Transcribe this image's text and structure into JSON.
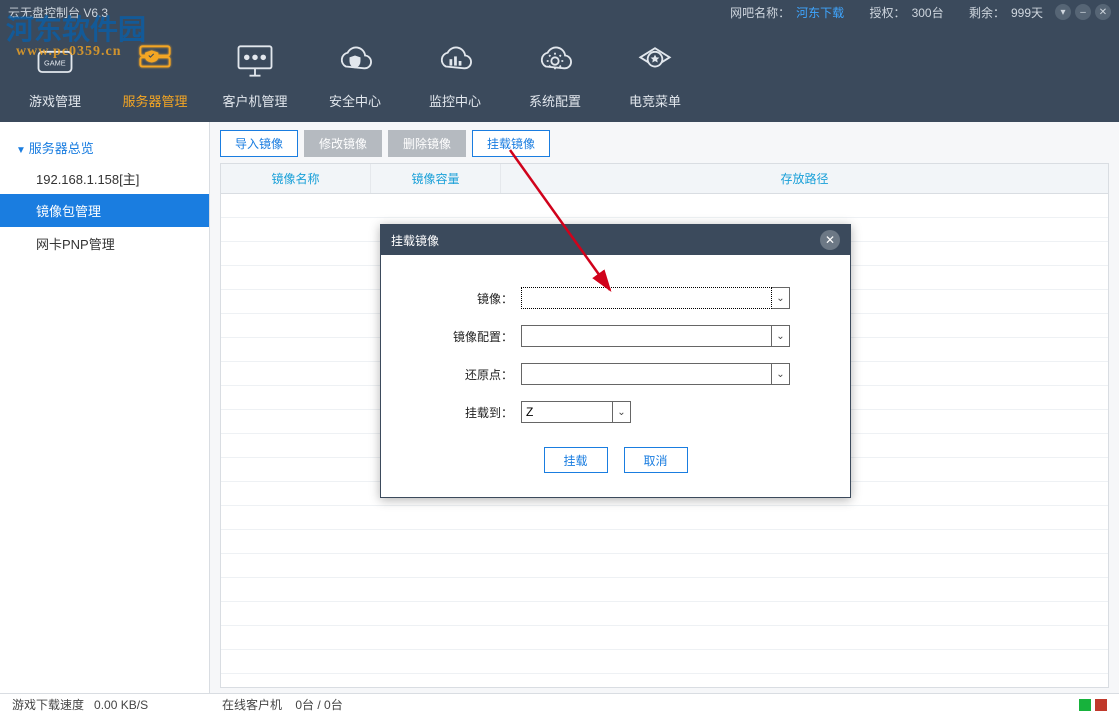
{
  "titlebar": {
    "app_title": "云无盘控制台 V6.3",
    "cafe_label": "网吧名称：",
    "cafe_name": "河东下载",
    "auth_label": "授权：",
    "auth_value": "300台",
    "remain_label": "剩余：",
    "remain_value": "999天"
  },
  "watermark": {
    "line1": "河东软件园",
    "line2": "www.pc0359.cn"
  },
  "nav": [
    {
      "key": "game",
      "label": "游戏管理"
    },
    {
      "key": "server",
      "label": "服务器管理"
    },
    {
      "key": "client",
      "label": "客户机管理"
    },
    {
      "key": "security",
      "label": "安全中心"
    },
    {
      "key": "monitor",
      "label": "监控中心"
    },
    {
      "key": "system",
      "label": "系统配置"
    },
    {
      "key": "esport",
      "label": "电竞菜单"
    }
  ],
  "sidebar": {
    "root": "服务器总览",
    "ip": "192.168.1.158[主]",
    "items": [
      "镜像包管理",
      "网卡PNP管理"
    ],
    "selected_index": 0
  },
  "toolbar": {
    "buttons": [
      {
        "label": "导入镜像",
        "style": "blue"
      },
      {
        "label": "修改镜像",
        "style": "gray"
      },
      {
        "label": "删除镜像",
        "style": "gray"
      },
      {
        "label": "挂载镜像",
        "style": "blue"
      }
    ]
  },
  "table": {
    "cols": [
      {
        "label": "镜像名称",
        "w": 150
      },
      {
        "label": "镜像容量",
        "w": 130
      },
      {
        "label": "存放路径",
        "w": 0
      }
    ]
  },
  "dialog": {
    "title": "挂载镜像",
    "fields": {
      "image_label": "镜像：",
      "image_value": "",
      "config_label": "镜像配置：",
      "config_value": "",
      "restore_label": "还原点：",
      "restore_value": "",
      "mount_label": "挂载到：",
      "mount_value": "Z"
    },
    "ok": "挂载",
    "cancel": "取消"
  },
  "status": {
    "speed_label": "游戏下载速度",
    "speed_value": "0.00 KB/S",
    "online_label": "在线客户机",
    "online_value": "0台 / 0台"
  }
}
